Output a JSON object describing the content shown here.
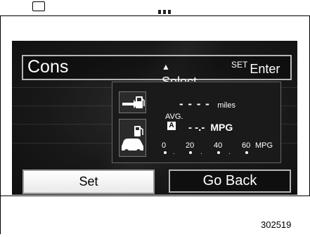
{
  "header": {
    "title": "Cons",
    "select_label": "Select",
    "set_label": "SET",
    "enter_label": "Enter"
  },
  "range": {
    "value": "- - - -",
    "unit": "miles"
  },
  "average": {
    "label": "AVG.",
    "badge": "A",
    "value": "- -.-",
    "unit": "MPG"
  },
  "scale": {
    "ticks": [
      "0",
      "20",
      "40",
      "60"
    ],
    "unit": "MPG"
  },
  "buttons": {
    "set": "Set",
    "back": "Go Back"
  },
  "caption": "302519",
  "icons": {
    "range": "fuel-pump-arrow-icon",
    "vehicle": "car-fuel-pump-icon",
    "select": "up-down-arrow-icon"
  }
}
